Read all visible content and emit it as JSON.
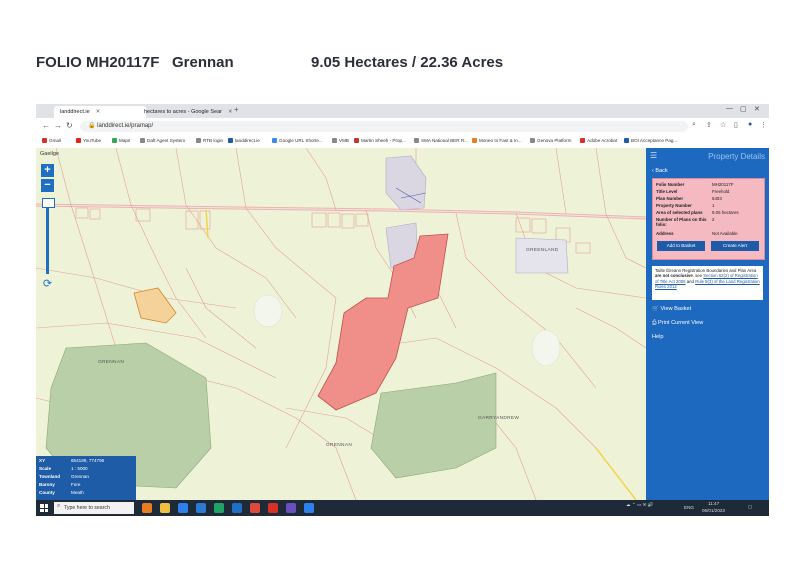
{
  "header": {
    "folio": "FOLIO MH20117F",
    "townland": "Grennan",
    "area": "9.05 Hectares  /  22.36 Acres"
  },
  "browser": {
    "tabs": [
      {
        "label": "landdirect.ie",
        "active": true
      },
      {
        "label": "hectares to acres - Google Sear",
        "active": false
      }
    ],
    "new_tab": "+",
    "url": "landdirect.ie/pramap/",
    "bookmarks": [
      "Gmail",
      "YouTube",
      "Maps",
      "Daft Agent System",
      "RTB login",
      "landdirect.ie",
      "Google URL Shorte...",
      "VMB",
      "Martin Sheeh - Prop...",
      "SMA National BER R...",
      "Moneo to Fast & In...",
      "Genova Platform",
      "Adobe Acrobat",
      "BOI Acceptance Pag..."
    ],
    "window_controls": [
      "—",
      "▢",
      "✕"
    ]
  },
  "map": {
    "language": "Gaeilge",
    "zoom_in": "+",
    "zoom_out": "−",
    "refresh": "⟳",
    "labels": [
      "GRENNAN",
      "GRENNAN",
      "GARRYANDREW",
      "GREENLAND"
    ],
    "info": [
      {
        "key": "XY",
        "value": "654189, 774796"
      },
      {
        "key": "Scale",
        "value": "1 : 5000"
      },
      {
        "key": "Townland",
        "value": "Grennan"
      },
      {
        "key": "Barony",
        "value": "Fore"
      },
      {
        "key": "County",
        "value": "Meath"
      }
    ],
    "colors": {
      "land": "#eef3d7",
      "selected_plot": "#f08f8a",
      "forest": "#b9cfa7",
      "boundary": "#e3a19a"
    }
  },
  "panel": {
    "title": "Property Details",
    "menu_icon": "☰",
    "back": "‹  Back",
    "details": [
      {
        "key": "Folio Number",
        "value": "MH20117F"
      },
      {
        "key": "Title Level",
        "value": "Freehold"
      },
      {
        "key": "Plan Number",
        "value": "5403"
      },
      {
        "key": "Property Number",
        "value": "1"
      },
      {
        "key": "Area of selected plans",
        "value": "9.05 hectares"
      },
      {
        "key": "Number of Plans on this folio:",
        "value": "2"
      },
      {
        "key": "Address",
        "value": "Not Available"
      }
    ],
    "add_to_basket": "Add to Basket",
    "create_alert": "Create Alert",
    "notice_a": "Tailte Éireann Registration Boundaries and Plan Area ",
    "notice_b": "are not conclusive",
    "notice_c": ". see ",
    "notice_link1": "Section 62(2) of Registration of Title Act 2006",
    "notice_d": " and ",
    "notice_link2": "Rule 8(3) of the Land Registration Rules 2012",
    "links": [
      "View Basket",
      "Print Current View",
      "Help"
    ]
  },
  "taskbar": {
    "search_placeholder": "Type here to search",
    "tray_lang": "ENG",
    "time": "11:47",
    "date": "06/01/2023"
  }
}
